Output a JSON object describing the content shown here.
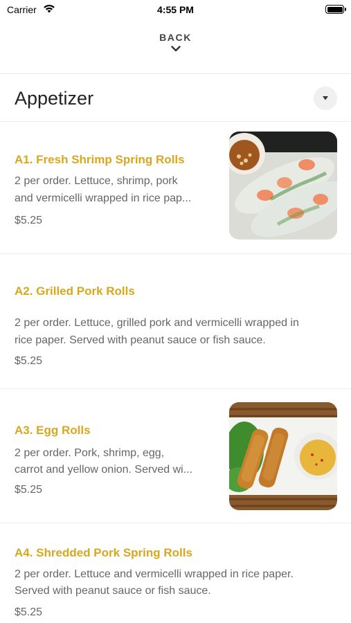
{
  "status_bar": {
    "carrier": "Carrier",
    "time": "4:55 PM"
  },
  "nav": {
    "back_label": "BACK"
  },
  "section": {
    "title": "Appetizer"
  },
  "items": [
    {
      "title": "A1. Fresh Shrimp Spring Rolls",
      "description_line1": "2 per order. Lettuce, shrimp, pork",
      "description_line2": "and vermicelli wrapped in rice pap...",
      "price": "$5.25",
      "has_photo": true
    },
    {
      "title": "A2. Grilled Pork Rolls",
      "description_line1": "2 per order. Lettuce, grilled pork and vermicelli wrapped in",
      "description_line2": "rice paper. Served with peanut sauce or fish sauce.",
      "price": "$5.25",
      "has_photo": false
    },
    {
      "title": "A3. Egg Rolls",
      "description_line1": "2 per order. Pork, shrimp, egg,",
      "description_line2": "carrot and yellow onion. Served wi...",
      "price": "$5.25",
      "has_photo": true
    },
    {
      "title": "A4. Shredded Pork Spring Rolls",
      "description_line1": "2 per order. Lettuce and vermicelli wrapped in rice paper.",
      "description_line2": "Served with peanut sauce or fish sauce.",
      "price": "$5.25",
      "has_photo": false
    }
  ],
  "colors": {
    "item_title": "#d9a71e",
    "text_secondary": "#666666",
    "divider": "#ececec"
  }
}
